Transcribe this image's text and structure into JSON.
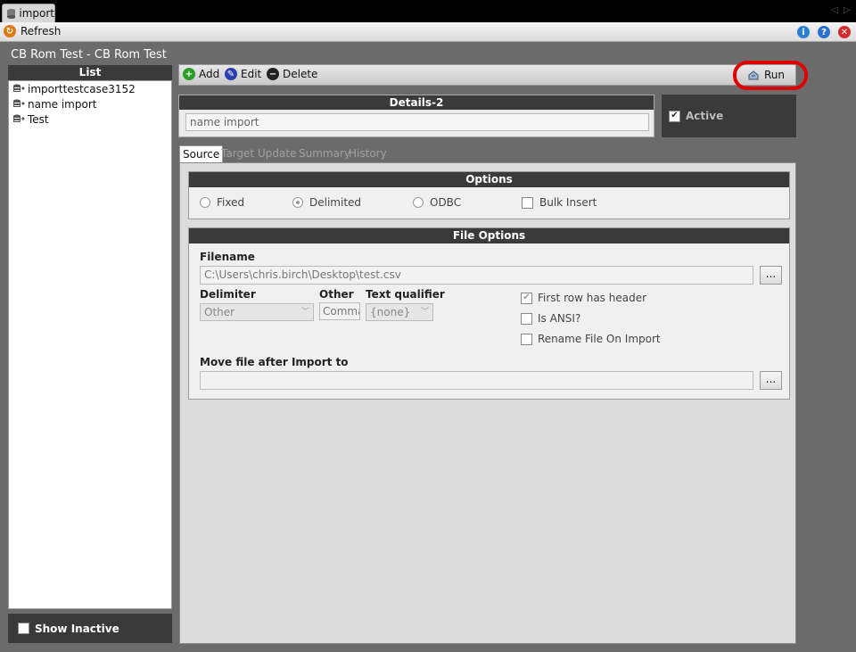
{
  "window": {
    "tab_label": "import",
    "icon": "database-icon"
  },
  "toolbar": {
    "refresh_label": "Refresh",
    "info_icon": "info-icon",
    "help_icon": "help-icon",
    "close_icon": "close-icon"
  },
  "page": {
    "title": "CB Rom Test - CB Rom Test"
  },
  "list": {
    "header": "List",
    "items": [
      {
        "label": "importtestcase3152"
      },
      {
        "label": "name import"
      },
      {
        "label": "Test"
      }
    ],
    "show_inactive_label": "Show Inactive"
  },
  "actions": {
    "add_label": "Add",
    "edit_label": "Edit",
    "delete_label": "Delete",
    "run_label": "Run"
  },
  "details": {
    "header": "Details-2",
    "name_value": "name import",
    "active_label": "Active",
    "active_checked": true
  },
  "tabs": [
    "Source",
    "Target",
    "Update",
    "Summary",
    "History"
  ],
  "options": {
    "header": "Options",
    "fixed_label": "Fixed",
    "delimited_label": "Delimited",
    "odbc_label": "ODBC",
    "bulk_insert_label": "Bulk Insert",
    "selected": "Delimited"
  },
  "file_options": {
    "header": "File Options",
    "filename_label": "Filename",
    "filename_value": "C:\\Users\\chris.birch\\Desktop\\test.csv",
    "browse_label": "...",
    "delimiter_label": "Delimiter",
    "delimiter_value": "Other",
    "other_label": "Other",
    "other_value": "Comma",
    "text_qualifier_label": "Text qualifier",
    "text_qualifier_value": "{none}",
    "first_row_header_label": "First row has header",
    "first_row_header_checked": true,
    "is_ansi_label": "Is ANSI?",
    "rename_label": "Rename File On Import",
    "move_label": "Move file after Import to",
    "move_value": "",
    "move_browse_label": "..."
  },
  "colors": {
    "dark_header": "#3a3a3a",
    "background": "#6b6b6b",
    "highlight": "#e00000"
  }
}
